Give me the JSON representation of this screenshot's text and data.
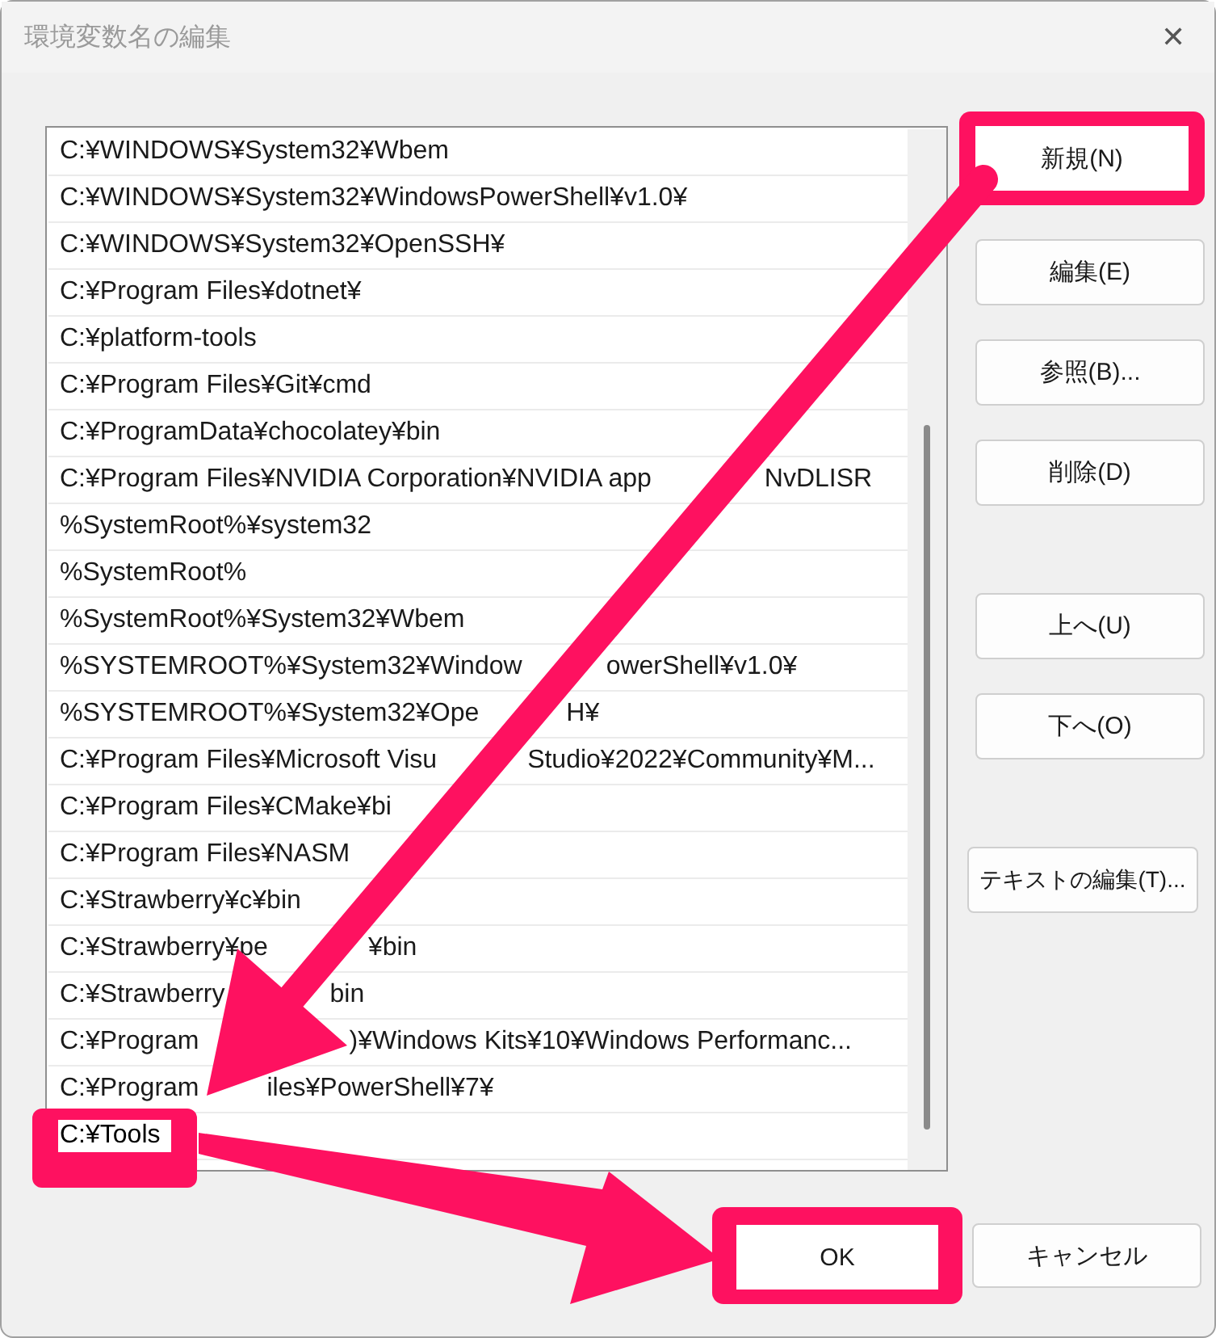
{
  "window": {
    "title": "環境変数名の編集",
    "close": "✕"
  },
  "list": {
    "items": [
      {
        "parts": [
          "C:¥WINDOWS¥System32¥Wbem"
        ],
        "selected": false
      },
      {
        "parts": [
          "C:¥WINDOWS¥System32¥WindowsPowerShell¥v1.0¥"
        ],
        "selected": false
      },
      {
        "parts": [
          "C:¥WINDOWS¥System32¥OpenSSH¥"
        ],
        "selected": false
      },
      {
        "parts": [
          "C:¥Program Files¥dotnet¥"
        ],
        "selected": false
      },
      {
        "parts": [
          "C:¥platform-tools"
        ],
        "selected": false
      },
      {
        "parts": [
          "C:¥Program Files¥Git¥cmd"
        ],
        "selected": false
      },
      {
        "parts": [
          "C:¥ProgramData¥chocolatey¥bin"
        ],
        "selected": false
      },
      {
        "parts": [
          "C:¥Program Files¥NVIDIA Corporation¥NVIDIA app",
          "NvDLISR"
        ],
        "selected": false
      },
      {
        "parts": [
          "%SystemRoot%¥system32"
        ],
        "selected": false
      },
      {
        "parts": [
          "%SystemRoot%"
        ],
        "selected": false
      },
      {
        "parts": [
          "%SystemRoot%¥System32¥Wbem"
        ],
        "selected": false
      },
      {
        "parts": [
          "%SYSTEMROOT%¥System32¥Window",
          "owerShell¥v1.0¥"
        ],
        "selected": false
      },
      {
        "parts": [
          "%SYSTEMROOT%¥System32¥Ope",
          "H¥"
        ],
        "selected": false
      },
      {
        "parts": [
          "C:¥Program Files¥Microsoft Visu",
          "Studio¥2022¥Community¥M..."
        ],
        "selected": false
      },
      {
        "parts": [
          "C:¥Program Files¥CMake¥bi"
        ],
        "selected": false
      },
      {
        "parts": [
          "C:¥Program Files¥NASM"
        ],
        "selected": false
      },
      {
        "parts": [
          "C:¥Strawberry¥c¥bin"
        ],
        "selected": false
      },
      {
        "parts": [
          "C:¥Strawberry¥pe",
          "¥bin"
        ],
        "selected": false
      },
      {
        "parts": [
          "C:¥Strawberry",
          "bin"
        ],
        "selected": false
      },
      {
        "parts": [
          "C:¥Program",
          ")¥Windows Kits¥10¥Windows Performanc..."
        ],
        "selected": false
      },
      {
        "parts": [
          "C:¥Program",
          "iles¥PowerShell¥7¥"
        ],
        "selected": false
      },
      {
        "parts": [
          "C:¥Tools"
        ],
        "selected": true,
        "highlighted": true
      }
    ]
  },
  "side_buttons": [
    {
      "label": "新規(N)",
      "highlighted": true
    },
    {
      "label": "編集(E)",
      "highlighted": false
    },
    {
      "label": "参照(B)...",
      "highlighted": false
    },
    {
      "label": "削除(D)",
      "highlighted": false
    },
    {
      "label": "上へ(U)",
      "highlighted": false
    },
    {
      "label": "下へ(O)",
      "highlighted": false
    },
    {
      "label": "テキストの編集(T)...",
      "highlighted": false
    }
  ],
  "footer_buttons": [
    {
      "label": "OK",
      "highlighted": true
    },
    {
      "label": "キャンセル",
      "highlighted": false
    }
  ]
}
